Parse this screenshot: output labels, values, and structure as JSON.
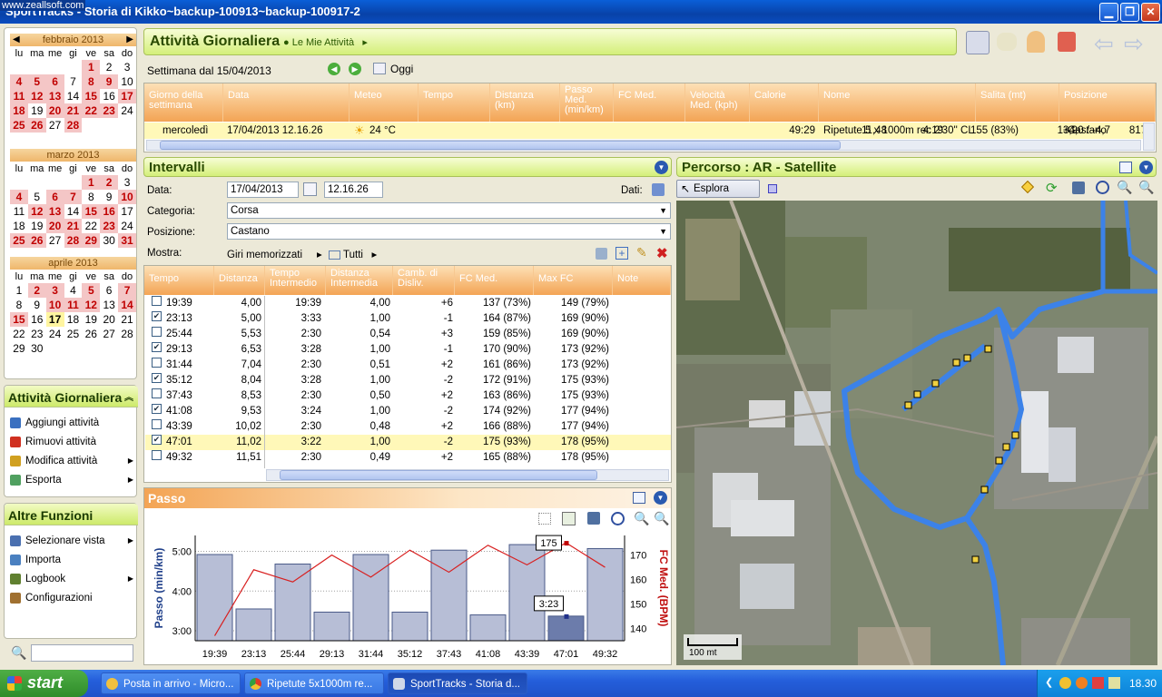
{
  "window": {
    "title": "SportTracks - Storia di Kikko~backup-100913~backup-100917-2",
    "watermark": "www.zeallsoft.com"
  },
  "calendars": [
    {
      "month": "febbraio 2013",
      "days": [
        "lu",
        "ma",
        "me",
        "gi",
        "ve",
        "sa",
        "do"
      ],
      "rows": [
        [
          "",
          "",
          "",
          "",
          "1",
          "2",
          "3"
        ],
        [
          "4",
          "5",
          "6",
          "7",
          "8",
          "9",
          "10"
        ],
        [
          "11",
          "12",
          "13",
          "14",
          "15",
          "16",
          "17"
        ],
        [
          "18",
          "19",
          "20",
          "21",
          "22",
          "23",
          "24"
        ],
        [
          "25",
          "26",
          "27",
          "28",
          "",
          "",
          ""
        ]
      ],
      "active": [
        "1",
        "4",
        "5",
        "6",
        "8",
        "9",
        "11",
        "12",
        "13",
        "15",
        "17",
        "18",
        "20",
        "21",
        "22",
        "23",
        "25",
        "26",
        "28"
      ]
    },
    {
      "month": "marzo 2013",
      "days": [
        "lu",
        "ma",
        "me",
        "gi",
        "ve",
        "sa",
        "do"
      ],
      "rows": [
        [
          "",
          "",
          "",
          "",
          "1",
          "2",
          "3"
        ],
        [
          "4",
          "5",
          "6",
          "7",
          "8",
          "9",
          "10"
        ],
        [
          "11",
          "12",
          "13",
          "14",
          "15",
          "16",
          "17"
        ],
        [
          "18",
          "19",
          "20",
          "21",
          "22",
          "23",
          "24"
        ],
        [
          "25",
          "26",
          "27",
          "28",
          "29",
          "30",
          "31"
        ]
      ],
      "active": [
        "1",
        "2",
        "4",
        "6",
        "7",
        "10",
        "12",
        "13",
        "15",
        "16",
        "20",
        "21",
        "23",
        "25",
        "26",
        "28",
        "29",
        "31"
      ]
    },
    {
      "month": "aprile 2013",
      "days": [
        "lu",
        "ma",
        "me",
        "gi",
        "ve",
        "sa",
        "do"
      ],
      "rows": [
        [
          "1",
          "2",
          "3",
          "4",
          "5",
          "6",
          "7"
        ],
        [
          "8",
          "9",
          "10",
          "11",
          "12",
          "13",
          "14"
        ],
        [
          "15",
          "16",
          "17",
          "18",
          "19",
          "20",
          "21"
        ],
        [
          "22",
          "23",
          "24",
          "25",
          "26",
          "27",
          "28"
        ],
        [
          "29",
          "30",
          "",
          "",
          "",
          "",
          ""
        ]
      ],
      "active": [
        "2",
        "3",
        "5",
        "7",
        "10",
        "11",
        "12",
        "14",
        "15"
      ],
      "today": "17"
    }
  ],
  "side_activities": {
    "title": "Attività Giornaliera",
    "items": [
      {
        "label": "Aggiungi attività",
        "icon": "add-icon",
        "color": "#3a70c0"
      },
      {
        "label": "Rimuovi attività",
        "icon": "remove-icon",
        "color": "#d03020"
      },
      {
        "label": "Modifica attività",
        "icon": "edit-icon",
        "color": "#d0a020"
      },
      {
        "label": "Esporta",
        "icon": "export-icon",
        "color": "#50a060"
      }
    ]
  },
  "side_functions": {
    "title": "Altre Funzioni",
    "items": [
      {
        "label": "Selezionare vista",
        "icon": "view-icon",
        "color": "#4a70b0"
      },
      {
        "label": "Importa",
        "icon": "import-icon",
        "color": "#4a80c0"
      },
      {
        "label": "Logbook",
        "icon": "logbook-icon",
        "color": "#608030"
      },
      {
        "label": "Configurazioni",
        "icon": "settings-icon",
        "color": "#a07030"
      }
    ]
  },
  "header": {
    "title": "Attività Giornaliera",
    "crumb": "Le Mie Attività"
  },
  "week": {
    "label": "Settimana dal 15/04/2013",
    "today": "Oggi"
  },
  "activity_table": {
    "columns": [
      "Giorno della settimana",
      "Data",
      "Meteo",
      "Tempo",
      "Distanza (km)",
      "Passo Med. (min/km)",
      "FC Med.",
      "Velocità Med. (kph)",
      "Calorie",
      "Nome",
      "Salita (mt)",
      "Posizione"
    ],
    "row": {
      "day": "mercoledì",
      "date": "17/04/2013 12.16.26",
      "weather": "24 °C",
      "time": "49:29",
      "distance": "11,48",
      "pace": "4:19",
      "hr": "155 (83%)",
      "speed": "13,9",
      "calories": "817",
      "name": "Ripetute 5 x 1000m rec 2'30'' CL",
      "climb": "+4,0 / -4,7",
      "place": "Castano"
    }
  },
  "intervals": {
    "title": "Intervalli",
    "date_label": "Data:",
    "date": "17/04/2013",
    "time": "12.16.26",
    "dati_label": "Dati:",
    "category_label": "Categoria:",
    "category": "Corsa",
    "place_label": "Posizione:",
    "place": "Castano",
    "show_label": "Mostra:",
    "show_value": "Giri memorizzati",
    "all_label": "Tutti",
    "columns": [
      "Tempo",
      "Distanza",
      "Tempo Intermedio",
      "Distanza Intermedia",
      "Camb. di Disliv.",
      "FC Med.",
      "Max FC",
      "Note"
    ],
    "rows": [
      {
        "checked": false,
        "t": "19:39",
        "d": "4,00",
        "ti": "19:39",
        "di": "4,00",
        "c": "+6",
        "fc": "137 (73%)",
        "mx": "149 (79%)"
      },
      {
        "checked": true,
        "t": "23:13",
        "d": "5,00",
        "ti": "3:33",
        "di": "1,00",
        "c": "-1",
        "fc": "164 (87%)",
        "mx": "169 (90%)"
      },
      {
        "checked": false,
        "t": "25:44",
        "d": "5,53",
        "ti": "2:30",
        "di": "0,54",
        "c": "+3",
        "fc": "159 (85%)",
        "mx": "169 (90%)"
      },
      {
        "checked": true,
        "t": "29:13",
        "d": "6,53",
        "ti": "3:28",
        "di": "1,00",
        "c": "-1",
        "fc": "170 (90%)",
        "mx": "173 (92%)"
      },
      {
        "checked": false,
        "t": "31:44",
        "d": "7,04",
        "ti": "2:30",
        "di": "0,51",
        "c": "+2",
        "fc": "161 (86%)",
        "mx": "173 (92%)"
      },
      {
        "checked": true,
        "t": "35:12",
        "d": "8,04",
        "ti": "3:28",
        "di": "1,00",
        "c": "-2",
        "fc": "172 (91%)",
        "mx": "175 (93%)"
      },
      {
        "checked": false,
        "t": "37:43",
        "d": "8,53",
        "ti": "2:30",
        "di": "0,50",
        "c": "+2",
        "fc": "163 (86%)",
        "mx": "175 (93%)"
      },
      {
        "checked": true,
        "t": "41:08",
        "d": "9,53",
        "ti": "3:24",
        "di": "1,00",
        "c": "-2",
        "fc": "174 (92%)",
        "mx": "177 (94%)"
      },
      {
        "checked": false,
        "t": "43:39",
        "d": "10,02",
        "ti": "2:30",
        "di": "0,48",
        "c": "+2",
        "fc": "166 (88%)",
        "mx": "177 (94%)"
      },
      {
        "checked": true,
        "t": "47:01",
        "d": "11,02",
        "ti": "3:22",
        "di": "1,00",
        "c": "-2",
        "fc": "175 (93%)",
        "mx": "178 (95%)",
        "selected": true
      },
      {
        "checked": false,
        "t": "49:32",
        "d": "11,51",
        "ti": "2:30",
        "di": "0,49",
        "c": "+2",
        "fc": "165 (88%)",
        "mx": "178 (95%)"
      }
    ]
  },
  "map": {
    "title": "Percorso  : AR - Satellite",
    "tool": "Esplora",
    "scale": "100 mt"
  },
  "pace_panel": {
    "title": "Passo"
  },
  "chart_data": {
    "type": "bar",
    "title": "",
    "categories": [
      "19:39",
      "23:13",
      "25:44",
      "29:13",
      "31:44",
      "35:12",
      "37:43",
      "41:08",
      "43:39",
      "47:01",
      "49:32"
    ],
    "series": [
      {
        "name": "Passo (min/km)",
        "values": [
          4.92,
          3.55,
          4.68,
          3.47,
          4.92,
          3.47,
          5.03,
          3.4,
          5.17,
          3.37,
          5.07
        ]
      },
      {
        "name": "FC Med. (BPM)",
        "values": [
          137,
          164,
          159,
          170,
          161,
          172,
          163,
          174,
          166,
          175,
          165
        ]
      }
    ],
    "ylabel": "Passo (min/km)",
    "y2label": "FC Med. (BPM)",
    "ylim": [
      2.75,
      5.4
    ],
    "y2lim": [
      135,
      178
    ],
    "yticks": [
      "3:00",
      "4:00",
      "5:00"
    ],
    "y2ticks": [
      "140",
      "150",
      "160",
      "170"
    ],
    "tooltips": [
      "175",
      "3:23"
    ],
    "bar_color": "#b7bed6",
    "line_color": "#d82020"
  },
  "taskbar": {
    "start": "start",
    "tasks": [
      "Posta in arrivo - Micro...",
      "Ripetute 5x1000m re...",
      "SportTracks - Storia d..."
    ],
    "clock": "18.30"
  }
}
